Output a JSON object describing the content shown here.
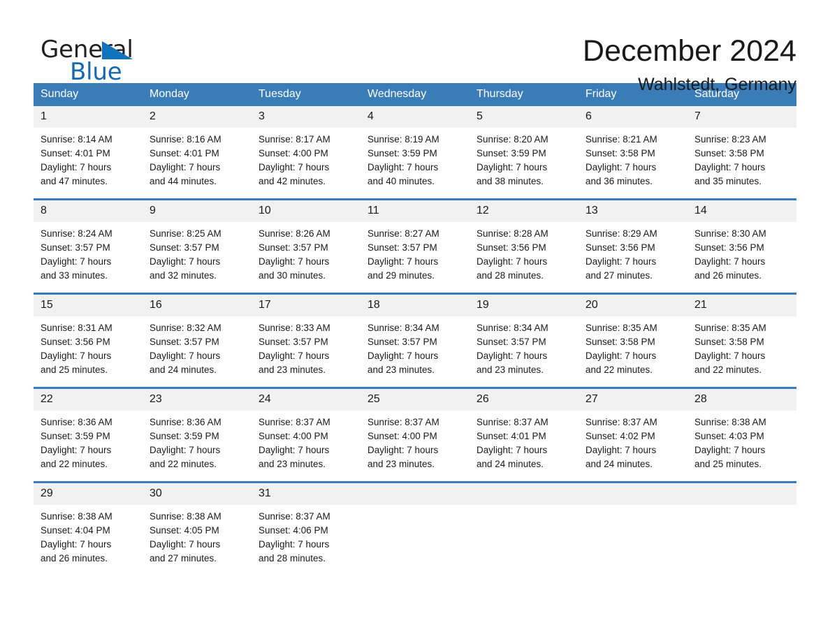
{
  "brand": {
    "name_part1": "General",
    "name_part2": "Blue",
    "triangle_color": "#1074bc",
    "text_color": "#231f20",
    "accent_color": "#1667b1"
  },
  "header": {
    "title": "December 2024",
    "location": "Wahlstedt, Germany"
  },
  "theme": {
    "header_bar_color": "#3a7cb8",
    "daynum_band_color": "#f1f1f1",
    "row_divider_color": "#3a7cb8",
    "text_color": "#1a1a1a"
  },
  "calendar": {
    "weekday_headers": [
      "Sunday",
      "Monday",
      "Tuesday",
      "Wednesday",
      "Thursday",
      "Friday",
      "Saturday"
    ],
    "weeks": [
      [
        {
          "day": "1",
          "sunrise": "Sunrise: 8:14 AM",
          "sunset": "Sunset: 4:01 PM",
          "daylight_line1": "Daylight: 7 hours",
          "daylight_line2": "and 47 minutes."
        },
        {
          "day": "2",
          "sunrise": "Sunrise: 8:16 AM",
          "sunset": "Sunset: 4:01 PM",
          "daylight_line1": "Daylight: 7 hours",
          "daylight_line2": "and 44 minutes."
        },
        {
          "day": "3",
          "sunrise": "Sunrise: 8:17 AM",
          "sunset": "Sunset: 4:00 PM",
          "daylight_line1": "Daylight: 7 hours",
          "daylight_line2": "and 42 minutes."
        },
        {
          "day": "4",
          "sunrise": "Sunrise: 8:19 AM",
          "sunset": "Sunset: 3:59 PM",
          "daylight_line1": "Daylight: 7 hours",
          "daylight_line2": "and 40 minutes."
        },
        {
          "day": "5",
          "sunrise": "Sunrise: 8:20 AM",
          "sunset": "Sunset: 3:59 PM",
          "daylight_line1": "Daylight: 7 hours",
          "daylight_line2": "and 38 minutes."
        },
        {
          "day": "6",
          "sunrise": "Sunrise: 8:21 AM",
          "sunset": "Sunset: 3:58 PM",
          "daylight_line1": "Daylight: 7 hours",
          "daylight_line2": "and 36 minutes."
        },
        {
          "day": "7",
          "sunrise": "Sunrise: 8:23 AM",
          "sunset": "Sunset: 3:58 PM",
          "daylight_line1": "Daylight: 7 hours",
          "daylight_line2": "and 35 minutes."
        }
      ],
      [
        {
          "day": "8",
          "sunrise": "Sunrise: 8:24 AM",
          "sunset": "Sunset: 3:57 PM",
          "daylight_line1": "Daylight: 7 hours",
          "daylight_line2": "and 33 minutes."
        },
        {
          "day": "9",
          "sunrise": "Sunrise: 8:25 AM",
          "sunset": "Sunset: 3:57 PM",
          "daylight_line1": "Daylight: 7 hours",
          "daylight_line2": "and 32 minutes."
        },
        {
          "day": "10",
          "sunrise": "Sunrise: 8:26 AM",
          "sunset": "Sunset: 3:57 PM",
          "daylight_line1": "Daylight: 7 hours",
          "daylight_line2": "and 30 minutes."
        },
        {
          "day": "11",
          "sunrise": "Sunrise: 8:27 AM",
          "sunset": "Sunset: 3:57 PM",
          "daylight_line1": "Daylight: 7 hours",
          "daylight_line2": "and 29 minutes."
        },
        {
          "day": "12",
          "sunrise": "Sunrise: 8:28 AM",
          "sunset": "Sunset: 3:56 PM",
          "daylight_line1": "Daylight: 7 hours",
          "daylight_line2": "and 28 minutes."
        },
        {
          "day": "13",
          "sunrise": "Sunrise: 8:29 AM",
          "sunset": "Sunset: 3:56 PM",
          "daylight_line1": "Daylight: 7 hours",
          "daylight_line2": "and 27 minutes."
        },
        {
          "day": "14",
          "sunrise": "Sunrise: 8:30 AM",
          "sunset": "Sunset: 3:56 PM",
          "daylight_line1": "Daylight: 7 hours",
          "daylight_line2": "and 26 minutes."
        }
      ],
      [
        {
          "day": "15",
          "sunrise": "Sunrise: 8:31 AM",
          "sunset": "Sunset: 3:56 PM",
          "daylight_line1": "Daylight: 7 hours",
          "daylight_line2": "and 25 minutes."
        },
        {
          "day": "16",
          "sunrise": "Sunrise: 8:32 AM",
          "sunset": "Sunset: 3:57 PM",
          "daylight_line1": "Daylight: 7 hours",
          "daylight_line2": "and 24 minutes."
        },
        {
          "day": "17",
          "sunrise": "Sunrise: 8:33 AM",
          "sunset": "Sunset: 3:57 PM",
          "daylight_line1": "Daylight: 7 hours",
          "daylight_line2": "and 23 minutes."
        },
        {
          "day": "18",
          "sunrise": "Sunrise: 8:34 AM",
          "sunset": "Sunset: 3:57 PM",
          "daylight_line1": "Daylight: 7 hours",
          "daylight_line2": "and 23 minutes."
        },
        {
          "day": "19",
          "sunrise": "Sunrise: 8:34 AM",
          "sunset": "Sunset: 3:57 PM",
          "daylight_line1": "Daylight: 7 hours",
          "daylight_line2": "and 23 minutes."
        },
        {
          "day": "20",
          "sunrise": "Sunrise: 8:35 AM",
          "sunset": "Sunset: 3:58 PM",
          "daylight_line1": "Daylight: 7 hours",
          "daylight_line2": "and 22 minutes."
        },
        {
          "day": "21",
          "sunrise": "Sunrise: 8:35 AM",
          "sunset": "Sunset: 3:58 PM",
          "daylight_line1": "Daylight: 7 hours",
          "daylight_line2": "and 22 minutes."
        }
      ],
      [
        {
          "day": "22",
          "sunrise": "Sunrise: 8:36 AM",
          "sunset": "Sunset: 3:59 PM",
          "daylight_line1": "Daylight: 7 hours",
          "daylight_line2": "and 22 minutes."
        },
        {
          "day": "23",
          "sunrise": "Sunrise: 8:36 AM",
          "sunset": "Sunset: 3:59 PM",
          "daylight_line1": "Daylight: 7 hours",
          "daylight_line2": "and 22 minutes."
        },
        {
          "day": "24",
          "sunrise": "Sunrise: 8:37 AM",
          "sunset": "Sunset: 4:00 PM",
          "daylight_line1": "Daylight: 7 hours",
          "daylight_line2": "and 23 minutes."
        },
        {
          "day": "25",
          "sunrise": "Sunrise: 8:37 AM",
          "sunset": "Sunset: 4:00 PM",
          "daylight_line1": "Daylight: 7 hours",
          "daylight_line2": "and 23 minutes."
        },
        {
          "day": "26",
          "sunrise": "Sunrise: 8:37 AM",
          "sunset": "Sunset: 4:01 PM",
          "daylight_line1": "Daylight: 7 hours",
          "daylight_line2": "and 24 minutes."
        },
        {
          "day": "27",
          "sunrise": "Sunrise: 8:37 AM",
          "sunset": "Sunset: 4:02 PM",
          "daylight_line1": "Daylight: 7 hours",
          "daylight_line2": "and 24 minutes."
        },
        {
          "day": "28",
          "sunrise": "Sunrise: 8:38 AM",
          "sunset": "Sunset: 4:03 PM",
          "daylight_line1": "Daylight: 7 hours",
          "daylight_line2": "and 25 minutes."
        }
      ],
      [
        {
          "day": "29",
          "sunrise": "Sunrise: 8:38 AM",
          "sunset": "Sunset: 4:04 PM",
          "daylight_line1": "Daylight: 7 hours",
          "daylight_line2": "and 26 minutes."
        },
        {
          "day": "30",
          "sunrise": "Sunrise: 8:38 AM",
          "sunset": "Sunset: 4:05 PM",
          "daylight_line1": "Daylight: 7 hours",
          "daylight_line2": "and 27 minutes."
        },
        {
          "day": "31",
          "sunrise": "Sunrise: 8:37 AM",
          "sunset": "Sunset: 4:06 PM",
          "daylight_line1": "Daylight: 7 hours",
          "daylight_line2": "and 28 minutes."
        },
        {
          "day": "",
          "sunrise": "",
          "sunset": "",
          "daylight_line1": "",
          "daylight_line2": ""
        },
        {
          "day": "",
          "sunrise": "",
          "sunset": "",
          "daylight_line1": "",
          "daylight_line2": ""
        },
        {
          "day": "",
          "sunrise": "",
          "sunset": "",
          "daylight_line1": "",
          "daylight_line2": ""
        },
        {
          "day": "",
          "sunrise": "",
          "sunset": "",
          "daylight_line1": "",
          "daylight_line2": ""
        }
      ]
    ]
  }
}
